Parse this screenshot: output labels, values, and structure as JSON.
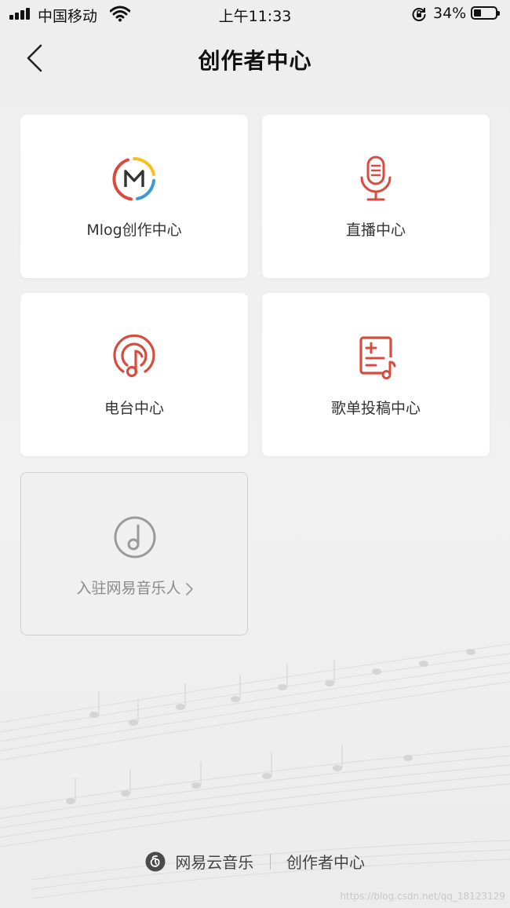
{
  "status_bar": {
    "carrier": "中国移动",
    "time": "上午11:33",
    "battery_percent": "34%",
    "battery_level": 0.34
  },
  "navbar": {
    "title": "创作者中心",
    "back_icon": "chevron-left-icon"
  },
  "cards": [
    {
      "label": "Mlog创作中心",
      "icon": "mlog-icon",
      "color": "#d84b3f"
    },
    {
      "label": "直播中心",
      "icon": "microphone-icon",
      "color": "#d84b3f"
    },
    {
      "label": "电台中心",
      "icon": "radio-music-icon",
      "color": "#d84b3f"
    },
    {
      "label": "歌单投稿中心",
      "icon": "playlist-submit-icon",
      "color": "#d84b3f"
    },
    {
      "label": "入驻网易音乐人",
      "icon": "music-note-circle-icon",
      "color": "#9a9a9a"
    }
  ],
  "footer": {
    "brand": "网易云音乐",
    "section": "创作者中心"
  },
  "watermark": "https://blog.csdn.net/qq_18123129",
  "colors": {
    "accent": "#d84b3f",
    "background": "#eeeeee",
    "card": "#ffffff"
  }
}
